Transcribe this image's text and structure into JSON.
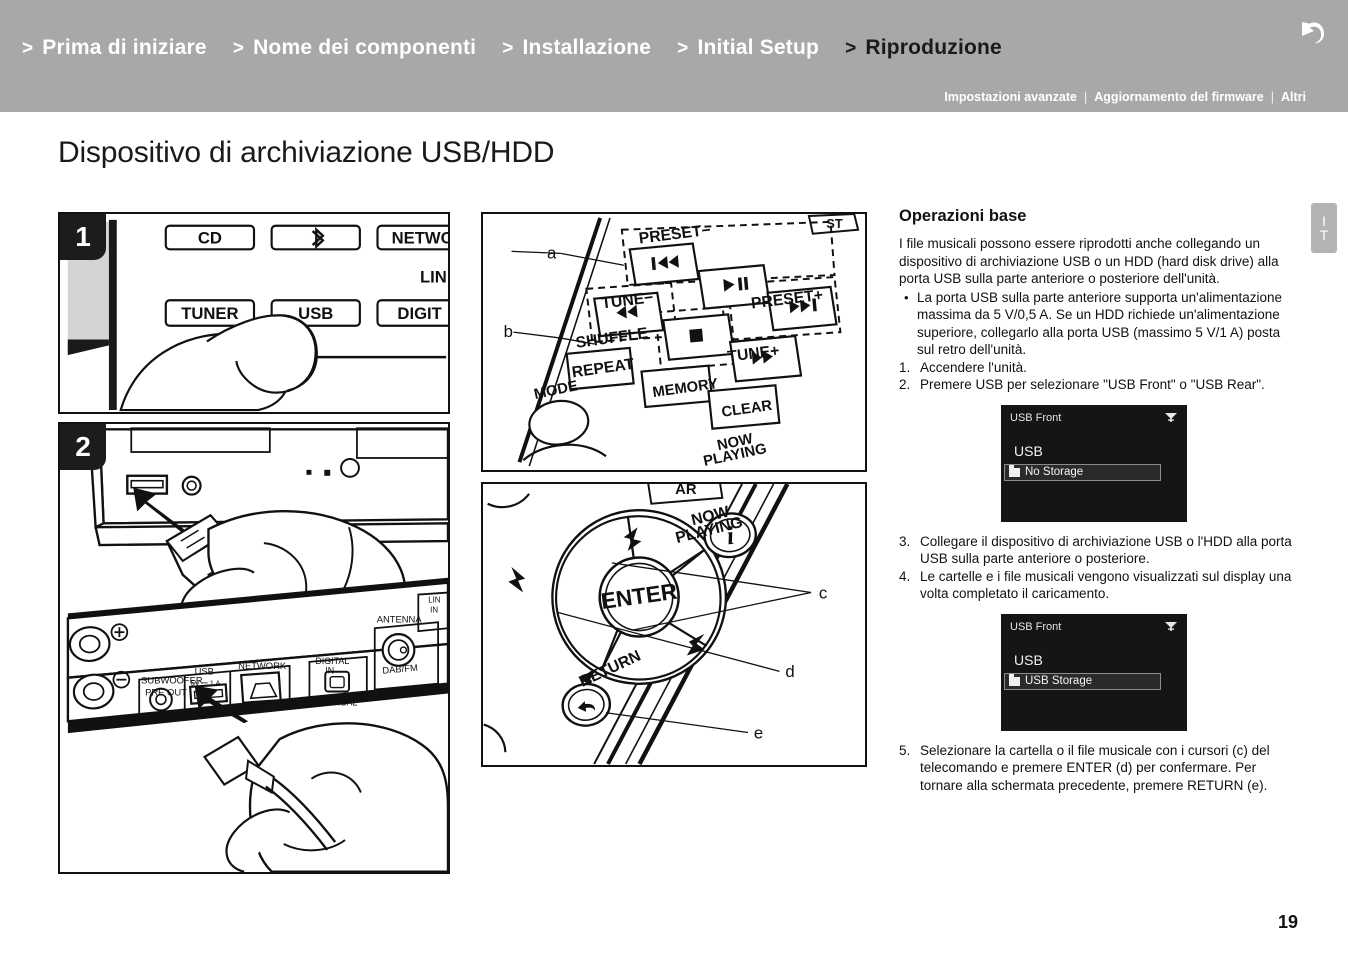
{
  "header": {
    "nav_items": [
      {
        "chevron": ">",
        "label": "Prima di iniziare",
        "active": false
      },
      {
        "chevron": ">",
        "label": "Nome dei componenti",
        "active": false
      },
      {
        "chevron": ">",
        "label": "Installazione",
        "active": false
      },
      {
        "chevron": ">",
        "label": "Initial Setup",
        "active": false
      },
      {
        "chevron": ">",
        "label": "Riproduzione",
        "active": true
      }
    ],
    "subnav": [
      {
        "label": "Impostazioni avanzate"
      },
      {
        "label": "Aggiornamento del firmware"
      },
      {
        "label": "Altri"
      }
    ],
    "separator": "|",
    "back_icon": "back-arrow-icon",
    "bg_color": "#a8a8a8"
  },
  "lang_tab": {
    "line1": "I",
    "line2": "T"
  },
  "page_title": "Dispositivo di archiviazione USB/HDD",
  "page_number": "19",
  "figures": {
    "fig1": {
      "badge": "1",
      "caption_name": "front-panel-input-buttons",
      "buttons": [
        "CD",
        "NETWO",
        "TUNER",
        "USB",
        "DIGIT",
        "LIN"
      ],
      "bluetooth_icon": "bluetooth-icon"
    },
    "fig2": {
      "badge": "2",
      "caption_name": "usb-connection-front-and-rear",
      "labels": [
        "SUBWOOFER",
        "PRE OUT",
        "USB",
        "5V 1A",
        "NETWORK",
        "DIGITAL",
        "IN",
        "OPTICAL",
        "ANTENNA",
        "DAB/FM",
        "LIN",
        "IN"
      ]
    },
    "fig3": {
      "caption_name": "remote-transport-buttons",
      "callouts": [
        "a",
        "b"
      ],
      "labels": [
        "PRESET−",
        "PRESET+",
        "TUNE−",
        "TUNE+",
        "SHUFFLE",
        "REPEAT",
        "MEMORY",
        "CLEAR",
        "MODE",
        "NOW",
        "PLAYING"
      ]
    },
    "fig4": {
      "caption_name": "remote-cursor-enter-return",
      "callouts": [
        "c",
        "d",
        "e"
      ],
      "labels": [
        "ENTER",
        "RETURN",
        "NOW",
        "PLAYING",
        "AR"
      ]
    }
  },
  "content": {
    "section_title": "Operazioni base",
    "intro": "I file musicali possono essere riprodotti anche collegando un dispositivo di archiviazione USB o un HDD (hard disk drive) alla porta USB sulla parte anteriore o posteriore dell'unità.",
    "bullets": [
      "La porta USB sulla parte anteriore supporta un'alimentazione massima da 5 V/0,5 A. Se un HDD richiede un'alimentazione superiore, collegarlo alla porta USB (massimo 5 V/1 A) posta sul retro dell'unità."
    ],
    "step1_num": "1.",
    "step1": "Accendere l'unità.",
    "step2_num": "2.",
    "step2": "Premere USB per selezionare \"USB Front\" o \"USB Rear\".",
    "step3_num": "3.",
    "step3": "Collegare il dispositivo di archiviazione USB o l'HDD alla porta USB sulla parte anteriore o posteriore.",
    "step4_num": "4.",
    "step4": "Le cartelle e i file musicali vengono visualizzati sul display una volta completato il caricamento.",
    "step5_num": "5.",
    "step5": "Selezionare la cartella o il file musicale con i cursori (c) del telecomando e premere ENTER (d) per confermare. Per tornare alla schermata precedente, premere RETURN (e)."
  },
  "display1": {
    "title": "USB Front",
    "wifi_icon": "wifi-icon",
    "header": "USB",
    "row_icon": "folder-icon",
    "row_label": "No Storage"
  },
  "display2": {
    "title": "USB Front",
    "wifi_icon": "wifi-icon",
    "header": "USB",
    "row_icon": "folder-icon",
    "row_label": "USB Storage"
  }
}
